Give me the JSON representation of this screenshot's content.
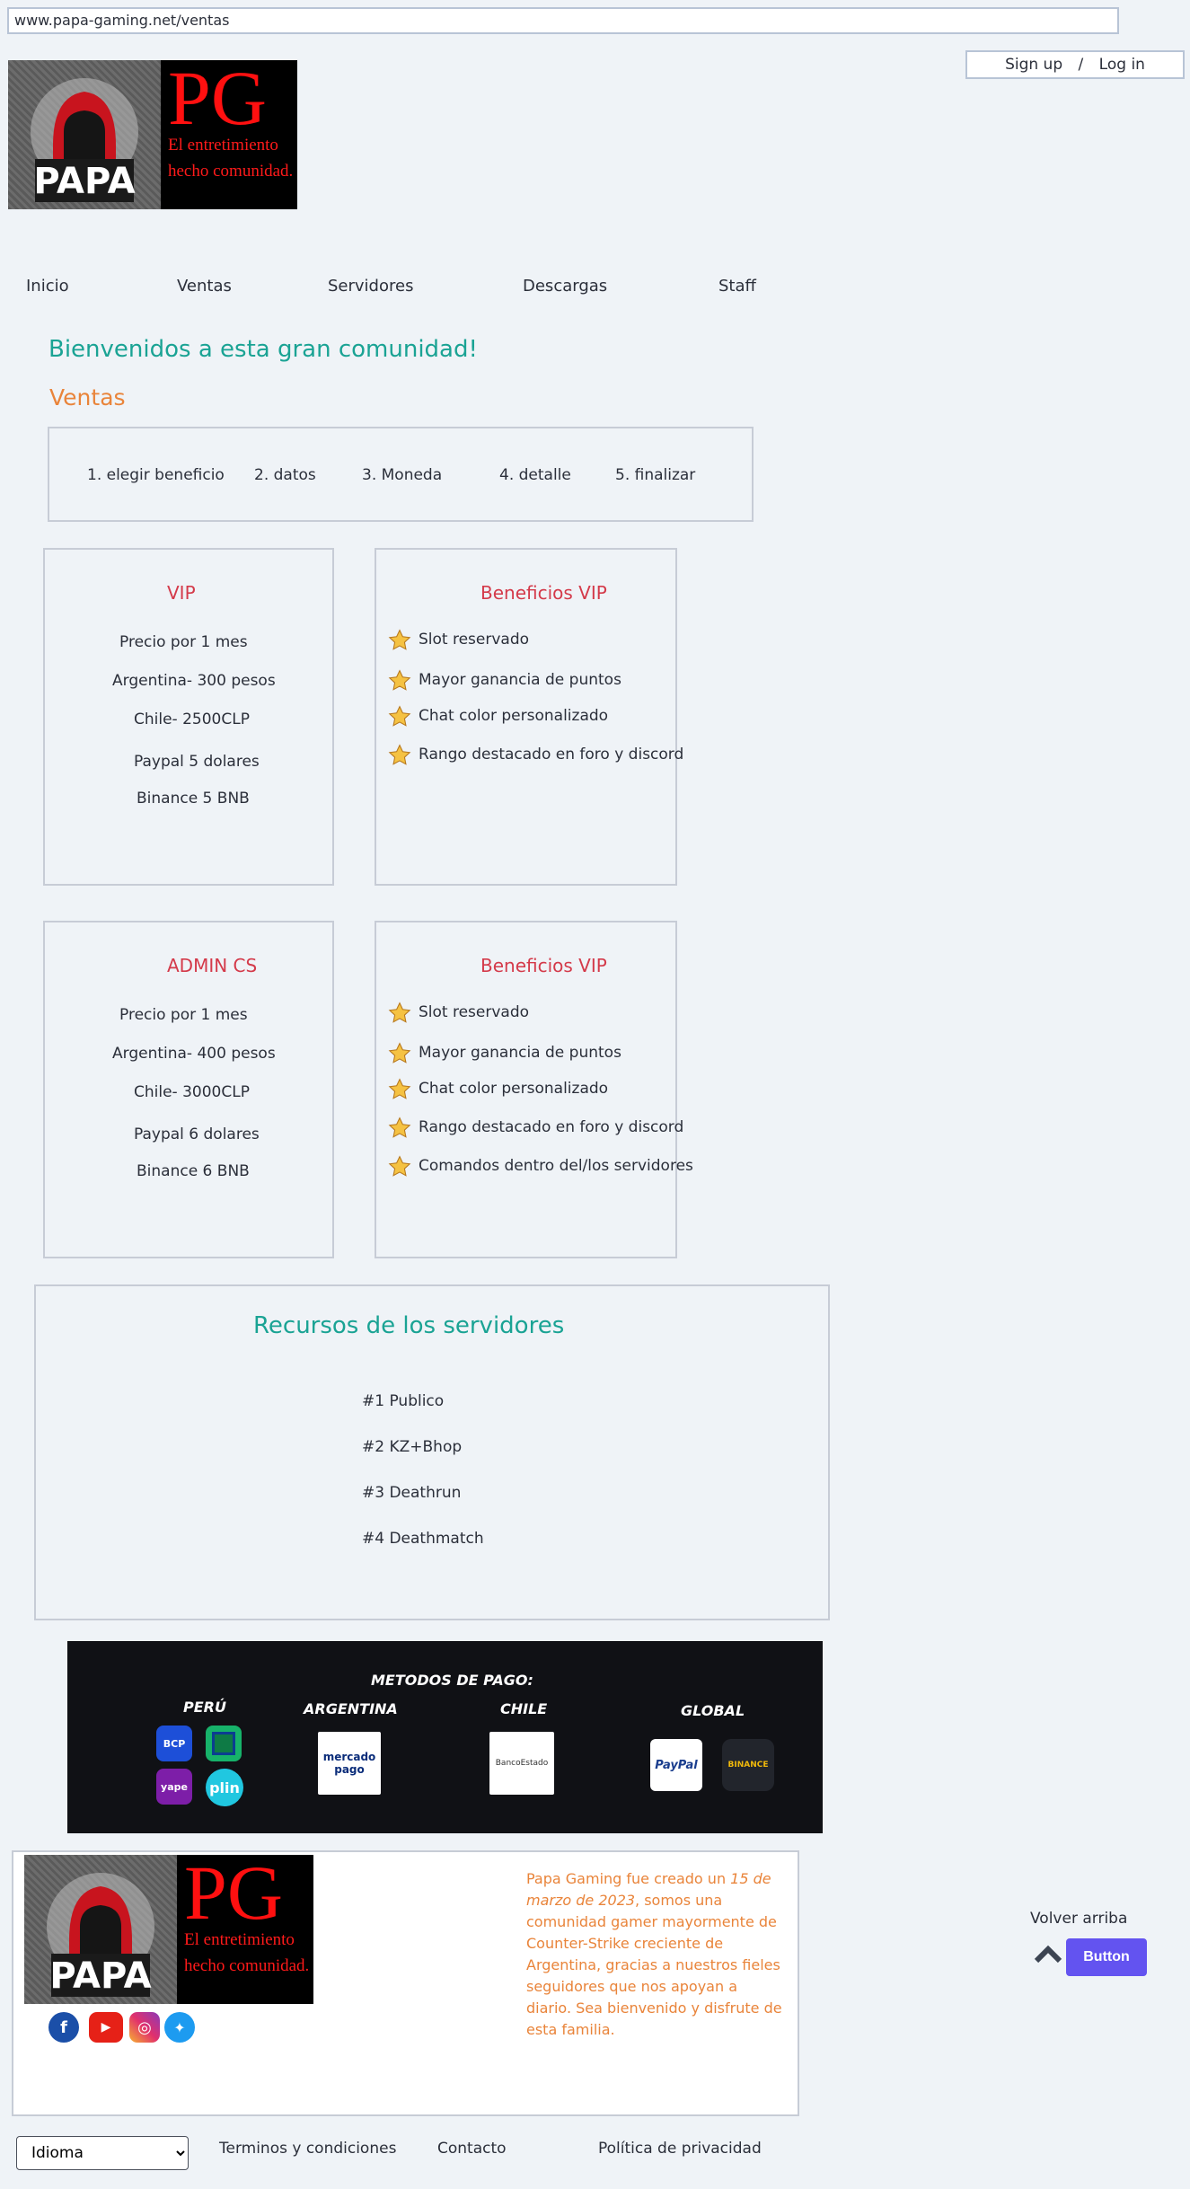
{
  "browser": {
    "url": "www.papa-gaming.net/ventas"
  },
  "auth": {
    "signup": "Sign up",
    "separator": "/",
    "login": "Log in"
  },
  "logo": {
    "initials": "PG",
    "tagline_1": "El entretimiento",
    "tagline_2": "hecho comunidad."
  },
  "nav": [
    "Inicio",
    "Ventas",
    "Servidores",
    "Descargas",
    "Staff"
  ],
  "welcome": "Bienvenidos a esta gran comunidad!",
  "section_title": "Ventas",
  "steps": [
    "1. elegir beneficio",
    "2. datos",
    "3.  Moneda",
    "4.  detalle",
    "5.  finalizar"
  ],
  "plans": [
    {
      "title": "VIP",
      "prices": [
        "Precio por 1 mes",
        "Argentina- 300 pesos",
        "Chile- 2500CLP",
        "Paypal 5 dolares",
        "Binance 5 BNB"
      ],
      "benefits_title": "Beneficios VIP",
      "benefits": [
        "Slot reservado",
        "Mayor ganancia de puntos",
        "Chat color personalizado",
        "Rango destacado en foro y discord"
      ]
    },
    {
      "title": "ADMIN CS",
      "prices": [
        "Precio por 1 mes",
        "Argentina- 400 pesos",
        "Chile- 3000CLP",
        "Paypal 6 dolares",
        "Binance 6 BNB"
      ],
      "benefits_title": "Beneficios VIP",
      "benefits": [
        "Slot reservado",
        "Mayor ganancia de puntos",
        "Chat color personalizado",
        "Rango destacado en foro y discord",
        "Comandos dentro del/los servidores"
      ]
    }
  ],
  "resources": {
    "title": "Recursos de los servidores",
    "items": [
      "#1 Publico",
      "#2 KZ+Bhop",
      "#3 Deathrun",
      "#4 Deathmatch"
    ]
  },
  "payment": {
    "title": "METODOS DE PAGO:",
    "regions": [
      "PERÚ",
      "ARGENTINA",
      "CHILE",
      "GLOBAL"
    ],
    "logos": {
      "bcp": "BCP",
      "yape": "yape",
      "plin": "plin",
      "mercadopago_1": "mercado",
      "mercadopago_2": "pago",
      "bancoestado": "BancoEstado",
      "paypal": "PayPal",
      "binance": "BINANCE"
    }
  },
  "about": {
    "text_before": "Papa Gaming fue creado un ",
    "date": "15 de marzo de 2023",
    "text_after": ", somos una comunidad gamer mayormente de Counter-Strike creciente de Argentina, gracias a nuestros fieles seguidores que nos apoyan a diario. Sea bienvenido y disfrute de esta familia."
  },
  "back_to_top": {
    "label": "Volver arriba",
    "button": "Button"
  },
  "footer": {
    "language": "Idioma",
    "links": [
      "Terminos y condiciones",
      "Contacto",
      "Política de privacidad"
    ]
  },
  "colors": {
    "teal": "#1aa394",
    "orange": "#e9843a",
    "red": "#d43a4a",
    "button": "#6353f0"
  }
}
